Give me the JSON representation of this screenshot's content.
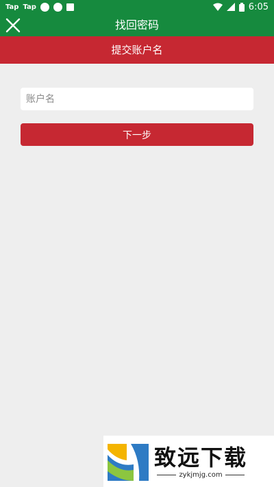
{
  "status_bar": {
    "left_labels": [
      "Tap",
      "Tap"
    ],
    "time": "6:05"
  },
  "app_bar": {
    "title": "找回密码"
  },
  "sub_bar": {
    "title": "提交账户名"
  },
  "form": {
    "username_placeholder": "账户名",
    "username_value": "",
    "next_label": "下一步"
  },
  "watermark": {
    "title": "致远下载",
    "url": "zykjmjg.com"
  },
  "colors": {
    "green": "#168a3e",
    "red": "#c62832",
    "background": "#eeeeee"
  }
}
